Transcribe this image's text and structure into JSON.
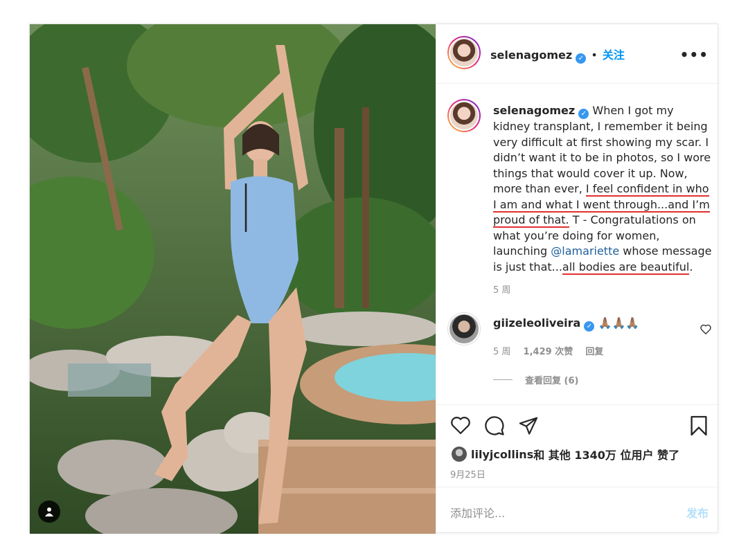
{
  "header": {
    "username": "selenagomez",
    "dot": "•",
    "follow_label": "关注",
    "more": "•••"
  },
  "caption": {
    "username": "selenagomez",
    "part1": "When I got my kidney transplant, I remember it being very difficult at first showing my scar. I didn’t want it to be in photos, so I wore things that would cover it up. Now, more than ever, ",
    "highlight1": "I feel confident in who I am and what I went through...and I’m proud of that.",
    "part2": " T - Congratulations on what you’re doing for women, launching ",
    "mention": "@lamariette",
    "part3": " whose message is just that...",
    "highlight2": "all bodies are beautiful",
    "part4": ".",
    "time": "5 周"
  },
  "comment": {
    "username": "giizeleoliveira",
    "text": "🙏🏽🙏🏽🙏🏽",
    "time": "5 周",
    "likes": "1,429 次赞",
    "reply": "回复",
    "view_replies": "查看回复 (6)"
  },
  "likes": {
    "user": "lilyjcollins",
    "rest": " 和 其他 1340万 位用户 赞了"
  },
  "date": "9月25日",
  "comment_box": {
    "placeholder": "添加评论...",
    "post_label": "发布"
  },
  "icons": [
    "heart-icon",
    "comment-icon",
    "share-icon",
    "bookmark-icon",
    "user-tag-icon",
    "verified-badge-icon",
    "more-options-icon"
  ]
}
